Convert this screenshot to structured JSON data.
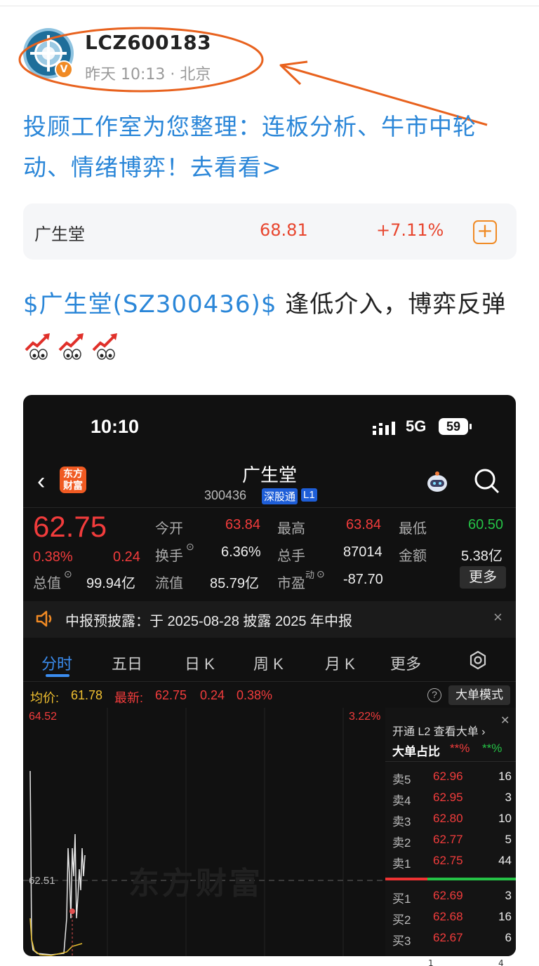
{
  "post": {
    "username": "LCZ600183",
    "time_location": "昨天 10:13 · 北京",
    "verified_badge": "V",
    "promo_text": "投顾工作室为您整理：连板分析、牛市中轮动、情绪博弈！去看看>",
    "content_tag": "$广生堂(SZ300436)$",
    "content_text": " 逢低介入，博弈反弹",
    "emoji": [
      "chart-up-eyes",
      "chart-up-eyes",
      "chart-up-eyes"
    ]
  },
  "stock_card": {
    "name": "广生堂",
    "price": "68.81",
    "change": "+7.11%",
    "add_icon": "plus-square-icon",
    "color": "#e8462f"
  },
  "annotation": {
    "color": "#e8621e",
    "shape": "ellipse-with-arrow"
  },
  "screenshot": {
    "status": {
      "time": "10:10",
      "network": "5G",
      "battery": "59"
    },
    "header": {
      "app_logo": "东方\n财富",
      "title": "广生堂",
      "code": "300436",
      "tag1": "深股通",
      "tag2": "L1"
    },
    "quote": {
      "price": "62.75",
      "pct": "0.38%",
      "chg": "0.24",
      "open_label": "今开",
      "open": "63.84",
      "high_label": "最高",
      "high": "63.84",
      "low_label": "最低",
      "low": "60.50",
      "turnover_label": "换手",
      "turnover": "6.36%",
      "volume_label": "总手",
      "volume": "87014",
      "amount_label": "金额",
      "amount": "5.38亿",
      "mktcap_label": "总值",
      "mktcap": "99.94亿",
      "float_label": "流值",
      "float": "85.79亿",
      "pe_label": "市盈",
      "pe_sup": "动",
      "pe": "-87.70",
      "more": "更多"
    },
    "notice": "中报预披露：于 2025-08-28 披露 2025 年中报",
    "tabs": [
      "分时",
      "五日",
      "日 K",
      "周 K",
      "月 K",
      "更多"
    ],
    "avg_line": {
      "avg_label": "均价:",
      "avg": "61.78",
      "last_label": "最新:",
      "last": "62.75",
      "chg": "0.24",
      "pct": "0.38%",
      "mode_button": "大单模式"
    },
    "chart": {
      "high_label": "64.52",
      "high_pct": "3.22%",
      "mid_label": "62.51",
      "watermark": "东方财富"
    },
    "orderbook": {
      "l2_text": "开通 L2 查看大单 ›",
      "ratio_label": "大单占比",
      "ratio_buy": "**%",
      "ratio_sell": "**%",
      "asks": [
        {
          "k": "卖5",
          "p": "62.96",
          "v": "16"
        },
        {
          "k": "卖4",
          "p": "62.95",
          "v": "3"
        },
        {
          "k": "卖3",
          "p": "62.80",
          "v": "10"
        },
        {
          "k": "卖2",
          "p": "62.77",
          "v": "5"
        },
        {
          "k": "卖1",
          "p": "62.75",
          "v": "44"
        }
      ],
      "bids": [
        {
          "k": "买1",
          "p": "62.69",
          "v": "3"
        },
        {
          "k": "买2",
          "p": "62.68",
          "v": "16"
        },
        {
          "k": "买3",
          "p": "62.67",
          "v": "6"
        }
      ]
    }
  },
  "bottom": {
    "n1": "1",
    "n2": "4"
  }
}
